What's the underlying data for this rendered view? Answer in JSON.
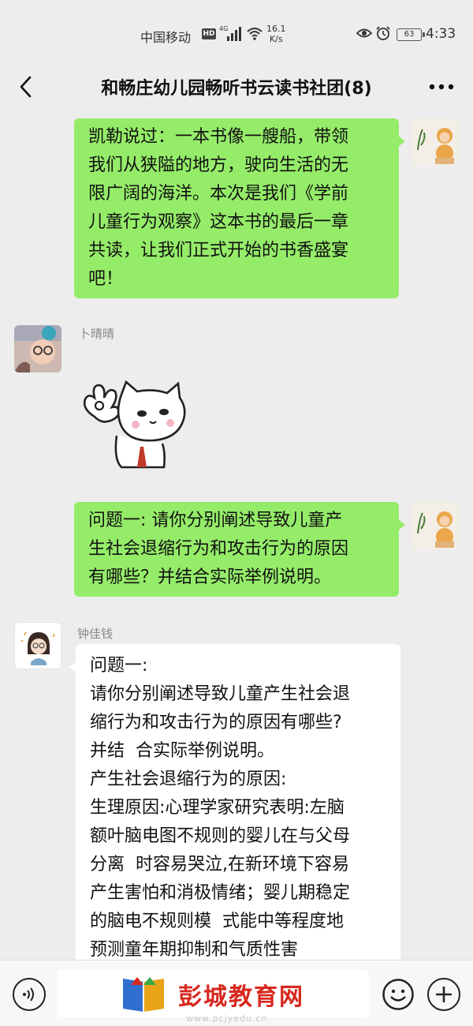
{
  "status_bar": {
    "carrier": "中国移动",
    "hd_badge": "HD",
    "network": "4G",
    "speed_value": "16.1",
    "speed_unit": "K/s",
    "battery": "63",
    "time": "4:33"
  },
  "header": {
    "title": "和畅庄幼儿园畅听书云读书社团(8)",
    "back_icon": "chevron-left-icon",
    "more_icon": "more-icon"
  },
  "messages": [
    {
      "direction": "out",
      "type": "text",
      "lines": [
        "凯勒说过：一本书像一艘船，带领",
        "我们从狭隘的地方，驶向生活的无",
        "限广阔的海洋。本次是我们《学前",
        "儿童行为观察》这本书的最后一章",
        "共读，让我们正式开始的书香盛宴",
        "吧！"
      ]
    },
    {
      "direction": "in",
      "type": "sticker",
      "sender": "卜晴晴",
      "sticker_icon": "ok-cat-sticker-icon"
    },
    {
      "direction": "out",
      "type": "text",
      "lines": [
        "问题一: 请你分别阐述导致儿童产",
        "生社会退缩行为和攻击行为的原因",
        "有哪些？并结合实际举例说明。"
      ]
    },
    {
      "direction": "in",
      "type": "text",
      "sender": "钟佳钱",
      "lines": [
        "问题一:",
        "请你分别阐述导致儿童产生社会退",
        "缩行为和攻击行为的原因有哪些?",
        "并结  合实际举例说明。",
        "产生社会退缩行为的原因:",
        "生理原因:心理学家研究表明:左脑",
        "额叶脑电图不规则的婴儿在与父母",
        "分离  时容易哭泣,在新环境下容易",
        "产生害怕和消极情绪；婴儿期稳定",
        "的脑电不规则模  式能中等程度地",
        "预测童年期抑制和气质性害"
      ]
    }
  ],
  "bottom_bar": {
    "voice_icon": "voice-icon",
    "emoji_icon": "emoji-icon",
    "plus_icon": "plus-icon"
  },
  "watermark": {
    "text": "彭城教育网",
    "url": "www.pcjyedu.cn"
  },
  "colors": {
    "background": "#ededed",
    "outgoing_bubble": "#95ec69",
    "incoming_bubble": "#ffffff",
    "watermark": "#d8281f"
  }
}
